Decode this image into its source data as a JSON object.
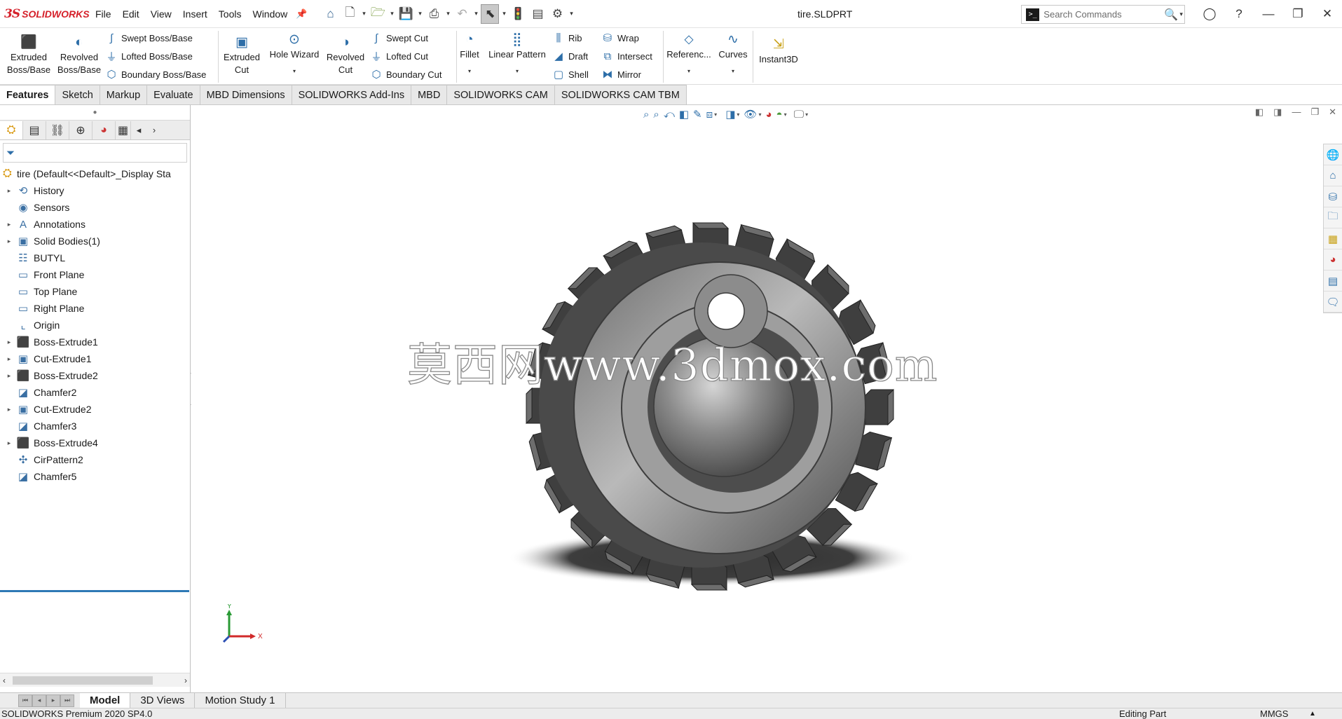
{
  "app": {
    "logo_ds": "3S",
    "logo_text": "SOLIDWORKS",
    "document_title": "tire.SLDPRT"
  },
  "menu": [
    "File",
    "Edit",
    "View",
    "Insert",
    "Tools",
    "Window"
  ],
  "search": {
    "placeholder": "Search Commands",
    "prompt_glyph": ">_"
  },
  "commands": {
    "extruded_boss": "Extruded\nBoss/Base",
    "revolved_boss": "Revolved\nBoss/Base",
    "swept_boss": "Swept Boss/Base",
    "lofted_boss": "Lofted Boss/Base",
    "boundary_boss": "Boundary Boss/Base",
    "extruded_cut": "Extruded\nCut",
    "hole_wizard": "Hole Wizard",
    "revolved_cut": "Revolved\nCut",
    "swept_cut": "Swept Cut",
    "lofted_cut": "Lofted Cut",
    "boundary_cut": "Boundary Cut",
    "fillet": "Fillet",
    "linear_pattern": "Linear Pattern",
    "rib": "Rib",
    "draft": "Draft",
    "shell": "Shell",
    "wrap": "Wrap",
    "intersect": "Intersect",
    "mirror": "Mirror",
    "reference": "Referenc...",
    "curves": "Curves",
    "instant3d": "Instant3D"
  },
  "tabs": [
    "Features",
    "Sketch",
    "Markup",
    "Evaluate",
    "MBD Dimensions",
    "SOLIDWORKS Add-Ins",
    "MBD",
    "SOLIDWORKS CAM",
    "SOLIDWORKS CAM TBM"
  ],
  "tree": {
    "root": "tire  (Default<<Default>_Display Sta",
    "items": [
      {
        "label": "History",
        "expandable": true,
        "icon": "history-icon"
      },
      {
        "label": "Sensors",
        "expandable": false,
        "icon": "sensor-icon"
      },
      {
        "label": "Annotations",
        "expandable": true,
        "icon": "annotation-icon"
      },
      {
        "label": "Solid Bodies(1)",
        "expandable": true,
        "icon": "solid-body-icon"
      },
      {
        "label": "BUTYL",
        "expandable": false,
        "icon": "material-icon"
      },
      {
        "label": "Front Plane",
        "expandable": false,
        "icon": "plane-icon"
      },
      {
        "label": "Top Plane",
        "expandable": false,
        "icon": "plane-icon"
      },
      {
        "label": "Right Plane",
        "expandable": false,
        "icon": "plane-icon"
      },
      {
        "label": "Origin",
        "expandable": false,
        "icon": "origin-icon"
      },
      {
        "label": "Boss-Extrude1",
        "expandable": true,
        "icon": "extrude-icon"
      },
      {
        "label": "Cut-Extrude1",
        "expandable": true,
        "icon": "cut-extrude-icon"
      },
      {
        "label": "Boss-Extrude2",
        "expandable": true,
        "icon": "extrude-icon"
      },
      {
        "label": "Chamfer2",
        "expandable": false,
        "icon": "chamfer-icon"
      },
      {
        "label": "Cut-Extrude2",
        "expandable": true,
        "icon": "cut-extrude-icon"
      },
      {
        "label": "Chamfer3",
        "expandable": false,
        "icon": "chamfer-icon"
      },
      {
        "label": "Boss-Extrude4",
        "expandable": true,
        "icon": "extrude-icon"
      },
      {
        "label": "CirPattern2",
        "expandable": false,
        "icon": "circular-pattern-icon"
      },
      {
        "label": "Chamfer5",
        "expandable": false,
        "icon": "chamfer-icon"
      }
    ]
  },
  "viewport": {
    "watermark": "莫西网www.3dmox.com",
    "triad_y": "Y",
    "triad_x": "X"
  },
  "bottom_tabs": [
    "Model",
    "3D Views",
    "Motion Study 1"
  ],
  "status": {
    "product": "SOLIDWORKS Premium 2020 SP4.0",
    "mode": "Editing Part",
    "units": "MMGS"
  },
  "colors": {
    "brand_red": "#d5202a",
    "accent_blue": "#2d6ea8",
    "rollback_bar": "#2e79b5",
    "model_gray": "#5a5a5a"
  }
}
